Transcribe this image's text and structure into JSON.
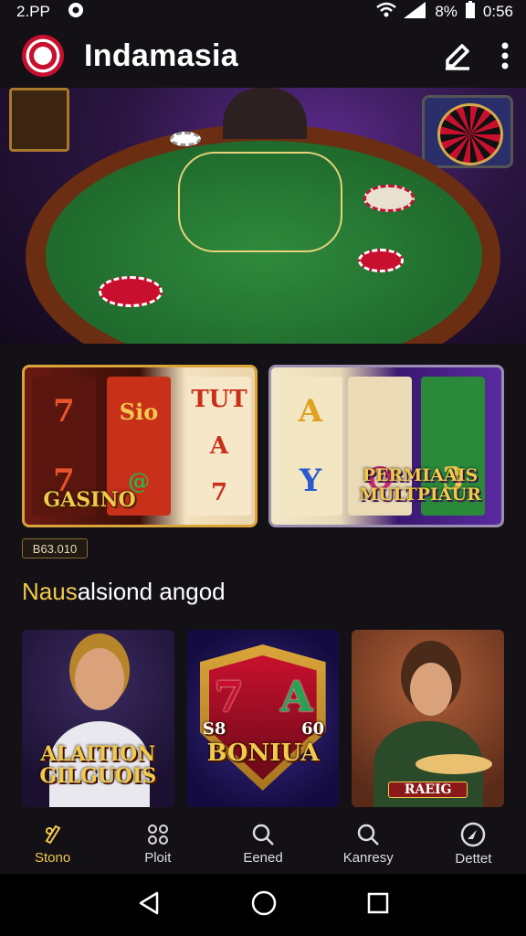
{
  "status_bar": {
    "time_left": "2.PP",
    "battery": "8%",
    "clock": "0:56"
  },
  "app_bar": {
    "title": "Indamasia"
  },
  "promos": [
    {
      "reel_symbols": [
        "7",
        "7",
        "Sio",
        "@",
        "TUT",
        "A",
        "7"
      ],
      "title": "GASINO"
    },
    {
      "reel_symbols": [
        "A",
        "Y",
        "O",
        "3"
      ],
      "title": "PERMIAAIS MULTPIAUR"
    }
  ],
  "price_tag": "B63.010",
  "section": {
    "title_accent": "Naus",
    "title_rest": "alsiond angod"
  },
  "games": [
    {
      "label": "ALAITION GILGUOIS"
    },
    {
      "label": "BONIUA",
      "side_left": "S8",
      "side_right": "60",
      "reel_left": "7",
      "reel_right": "A"
    },
    {
      "label": "RAEIG"
    }
  ],
  "bottom_nav": [
    {
      "label": "Stono",
      "icon": "casino-icon",
      "active": true
    },
    {
      "label": "Ploit",
      "icon": "grid-icon",
      "active": false
    },
    {
      "label": "Eened",
      "icon": "search-icon",
      "active": false
    },
    {
      "label": "Kanresy",
      "icon": "search-icon",
      "active": false
    },
    {
      "label": "Dettet",
      "icon": "compass-icon",
      "active": false
    }
  ],
  "colors": {
    "background": "#141116",
    "accent": "#f2c94c",
    "felt": "#1f6a2c"
  }
}
